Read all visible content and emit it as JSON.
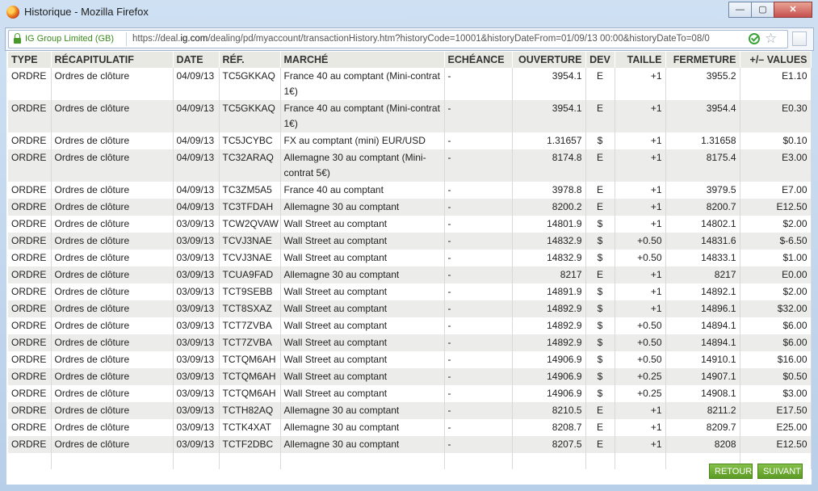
{
  "window": {
    "title": "Historique - Mozilla Firefox",
    "minimize": "—",
    "maximize": "▢",
    "close": "✕"
  },
  "navbar": {
    "identity": "IG Group Limited (GB)",
    "url_prefix": "https://deal.",
    "url_domain": "ig.com",
    "url_rest": "/dealing/pd/myaccount/transactionHistory.htm?historyCode=10001&historyDateFrom=01/09/13 00:00&historyDateTo=08/0"
  },
  "table": {
    "headers": [
      "TYPE",
      "RÉCAPITULATIF",
      "DATE",
      "RÉF.",
      "MARCHÉ",
      "ECHÉANCE",
      "OUVERTURE",
      "DEV",
      "TAILLE",
      "FERMETURE",
      "+/– VALUES"
    ],
    "rows": [
      [
        "ORDRE",
        "Ordres de clôture",
        "04/09/13",
        "TC5GKKAQ",
        "France 40 au comptant (Mini-contrat 1€)",
        "-",
        "3954.1",
        "E",
        "+1",
        "3955.2",
        "E1.10"
      ],
      [
        "ORDRE",
        "Ordres de clôture",
        "04/09/13",
        "TC5GKKAQ",
        "France 40 au comptant (Mini-contrat 1€)",
        "-",
        "3954.1",
        "E",
        "+1",
        "3954.4",
        "E0.30"
      ],
      [
        "ORDRE",
        "Ordres de clôture",
        "04/09/13",
        "TC5JCYBC",
        "FX au comptant (mini) EUR/USD",
        "-",
        "1.31657",
        "$",
        "+1",
        "1.31658",
        "$0.10"
      ],
      [
        "ORDRE",
        "Ordres de clôture",
        "04/09/13",
        "TC32ARAQ",
        "Allemagne 30 au comptant (Mini-contrat 5€)",
        "-",
        "8174.8",
        "E",
        "+1",
        "8175.4",
        "E3.00"
      ],
      [
        "ORDRE",
        "Ordres de clôture",
        "04/09/13",
        "TC3ZM5A5",
        "France 40 au comptant",
        "-",
        "3978.8",
        "E",
        "+1",
        "3979.5",
        "E7.00"
      ],
      [
        "ORDRE",
        "Ordres de clôture",
        "04/09/13",
        "TC3TFDAH",
        "Allemagne 30 au comptant",
        "-",
        "8200.2",
        "E",
        "+1",
        "8200.7",
        "E12.50"
      ],
      [
        "ORDRE",
        "Ordres de clôture",
        "03/09/13",
        "TCW2QVAW",
        "Wall Street au comptant",
        "-",
        "14801.9",
        "$",
        "+1",
        "14802.1",
        "$2.00"
      ],
      [
        "ORDRE",
        "Ordres de clôture",
        "03/09/13",
        "TCVJ3NAE",
        "Wall Street au comptant",
        "-",
        "14832.9",
        "$",
        "+0.50",
        "14831.6",
        "$-6.50"
      ],
      [
        "ORDRE",
        "Ordres de clôture",
        "03/09/13",
        "TCVJ3NAE",
        "Wall Street au comptant",
        "-",
        "14832.9",
        "$",
        "+0.50",
        "14833.1",
        "$1.00"
      ],
      [
        "ORDRE",
        "Ordres de clôture",
        "03/09/13",
        "TCUA9FAD",
        "Allemagne 30 au comptant",
        "-",
        "8217",
        "E",
        "+1",
        "8217",
        "E0.00"
      ],
      [
        "ORDRE",
        "Ordres de clôture",
        "03/09/13",
        "TCT9SEBB",
        "Wall Street au comptant",
        "-",
        "14891.9",
        "$",
        "+1",
        "14892.1",
        "$2.00"
      ],
      [
        "ORDRE",
        "Ordres de clôture",
        "03/09/13",
        "TCT8SXAZ",
        "Wall Street au comptant",
        "-",
        "14892.9",
        "$",
        "+1",
        "14896.1",
        "$32.00"
      ],
      [
        "ORDRE",
        "Ordres de clôture",
        "03/09/13",
        "TCT7ZVBA",
        "Wall Street au comptant",
        "-",
        "14892.9",
        "$",
        "+0.50",
        "14894.1",
        "$6.00"
      ],
      [
        "ORDRE",
        "Ordres de clôture",
        "03/09/13",
        "TCT7ZVBA",
        "Wall Street au comptant",
        "-",
        "14892.9",
        "$",
        "+0.50",
        "14894.1",
        "$6.00"
      ],
      [
        "ORDRE",
        "Ordres de clôture",
        "03/09/13",
        "TCTQM6AH",
        "Wall Street au comptant",
        "-",
        "14906.9",
        "$",
        "+0.50",
        "14910.1",
        "$16.00"
      ],
      [
        "ORDRE",
        "Ordres de clôture",
        "03/09/13",
        "TCTQM6AH",
        "Wall Street au comptant",
        "-",
        "14906.9",
        "$",
        "+0.25",
        "14907.1",
        "$0.50"
      ],
      [
        "ORDRE",
        "Ordres de clôture",
        "03/09/13",
        "TCTQM6AH",
        "Wall Street au comptant",
        "-",
        "14906.9",
        "$",
        "+0.25",
        "14908.1",
        "$3.00"
      ],
      [
        "ORDRE",
        "Ordres de clôture",
        "03/09/13",
        "TCTH82AQ",
        "Allemagne 30 au comptant",
        "-",
        "8210.5",
        "E",
        "+1",
        "8211.2",
        "E17.50"
      ],
      [
        "ORDRE",
        "Ordres de clôture",
        "03/09/13",
        "TCTK4XAT",
        "Allemagne 30 au comptant",
        "-",
        "8208.7",
        "E",
        "+1",
        "8209.7",
        "E25.00"
      ],
      [
        "ORDRE",
        "Ordres de clôture",
        "03/09/13",
        "TCTF2DBC",
        "Allemagne 30 au comptant",
        "-",
        "8207.5",
        "E",
        "+1",
        "8208",
        "E12.50"
      ]
    ]
  },
  "buttons": {
    "back": "RETOUR",
    "next": "SUIVANT"
  },
  "colors": {
    "button_green": "#6aa82d",
    "row_alt": "#ececea",
    "secure_green": "#3b8a1e"
  }
}
